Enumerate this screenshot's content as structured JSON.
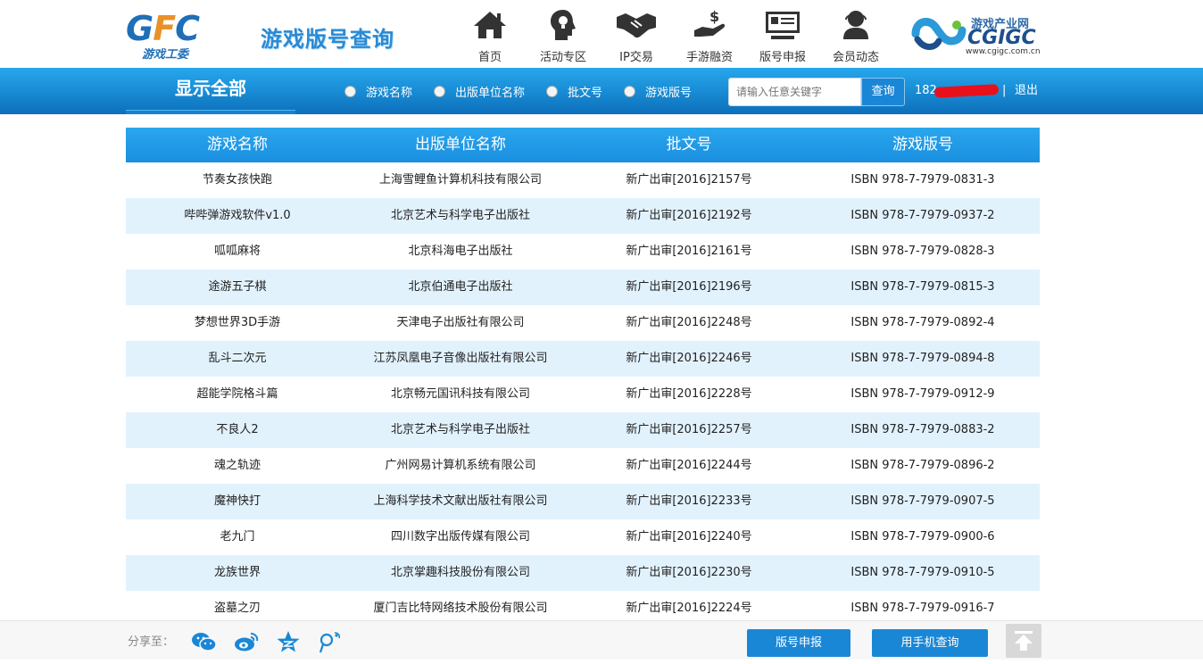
{
  "header": {
    "logo_text": "GFC",
    "logo_sub": "游戏工委",
    "site_title": "游戏版号查询",
    "nav": [
      {
        "label": "首页",
        "icon": "home-icon"
      },
      {
        "label": "活动专区",
        "icon": "head-lightbulb-icon"
      },
      {
        "label": "IP交易",
        "icon": "handshake-icon"
      },
      {
        "label": "手游融资",
        "icon": "money-hand-icon"
      },
      {
        "label": "版号申报",
        "icon": "monitor-icon"
      },
      {
        "label": "会员动态",
        "icon": "member-icon"
      }
    ],
    "partner_logo": {
      "cn": "游戏产业网",
      "en": "CGIGC",
      "url": "www.cgigc.com.cn"
    }
  },
  "searchbar": {
    "show_all": "显示全部",
    "options": [
      "游戏名称",
      "出版单位名称",
      "批文号",
      "游戏版号"
    ],
    "placeholder": "请输入任意关键字",
    "search_label": "查询",
    "user_prefix": "182",
    "separator": "|",
    "logout": "退出"
  },
  "table": {
    "headers": [
      "游戏名称",
      "出版单位名称",
      "批文号",
      "游戏版号"
    ],
    "rows": [
      [
        "节奏女孩快跑",
        "上海雪鲤鱼计算机科技有限公司",
        "新广出审[2016]2157号",
        "ISBN 978-7-7979-0831-3"
      ],
      [
        "哔哔弹游戏软件v1.0",
        "北京艺术与科学电子出版社",
        "新广出审[2016]2192号",
        "ISBN 978-7-7979-0937-2"
      ],
      [
        "呱呱麻将",
        "北京科海电子出版社",
        "新广出审[2016]2161号",
        "ISBN 978-7-7979-0828-3"
      ],
      [
        "途游五子棋",
        "北京伯通电子出版社",
        "新广出审[2016]2196号",
        "ISBN 978-7-7979-0815-3"
      ],
      [
        "梦想世界3D手游",
        "天津电子出版社有限公司",
        "新广出审[2016]2248号",
        "ISBN 978-7-7979-0892-4"
      ],
      [
        "乱斗二次元",
        "江苏凤凰电子音像出版社有限公司",
        "新广出审[2016]2246号",
        "ISBN 978-7-7979-0894-8"
      ],
      [
        "超能学院格斗篇",
        "北京畅元国讯科技有限公司",
        "新广出审[2016]2228号",
        "ISBN 978-7-7979-0912-9"
      ],
      [
        "不良人2",
        "北京艺术与科学电子出版社",
        "新广出审[2016]2257号",
        "ISBN 978-7-7979-0883-2"
      ],
      [
        "魂之轨迹",
        "广州网易计算机系统有限公司",
        "新广出审[2016]2244号",
        "ISBN 978-7-7979-0896-2"
      ],
      [
        "魔神快打",
        "上海科学技术文献出版社有限公司",
        "新广出审[2016]2233号",
        "ISBN 978-7-7979-0907-5"
      ],
      [
        "老九门",
        "四川数字出版传媒有限公司",
        "新广出审[2016]2240号",
        "ISBN 978-7-7979-0900-6"
      ],
      [
        "龙族世界",
        "北京掌趣科技股份有限公司",
        "新广出审[2016]2230号",
        "ISBN 978-7-7979-0910-5"
      ],
      [
        "盗墓之刃",
        "厦门吉比特网络技术股份有限公司",
        "新广出审[2016]2224号",
        "ISBN 978-7-7979-0916-7"
      ]
    ]
  },
  "footer": {
    "share_label": "分享至：",
    "share_icons": [
      "wechat-icon",
      "weibo-icon",
      "qzone-icon",
      "tencent-weibo-icon"
    ],
    "apply_label": "版号申报",
    "mobile_label": "用手机查询"
  },
  "colors": {
    "accent": "#1a87d6",
    "bar_top": "#27a7ec",
    "bar_bottom": "#0d6fbb",
    "row_alt": "#e2f2fd",
    "logo_orange": "#e8912a"
  }
}
